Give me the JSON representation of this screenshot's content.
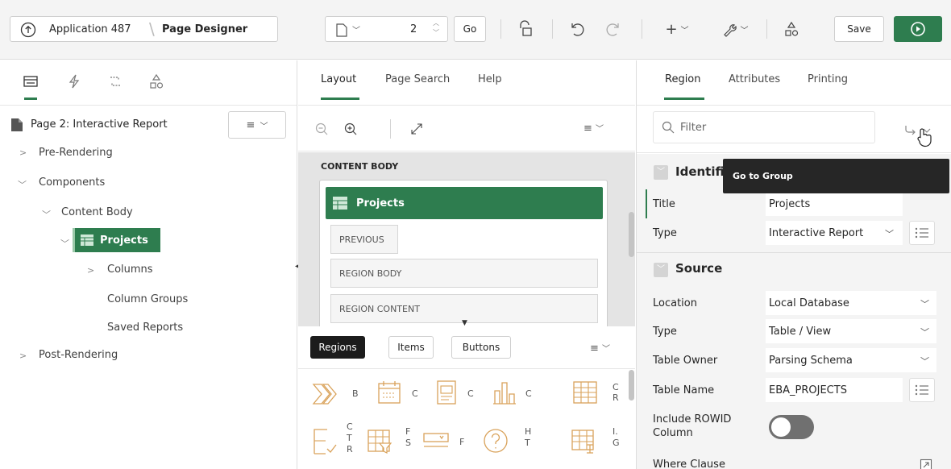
{
  "header": {
    "app_label": "Application 487",
    "page_designer_label": "Page Designer",
    "page_number": "2",
    "go_label": "Go",
    "save_label": "Save"
  },
  "left": {
    "page_title": "Page 2: Interactive Report",
    "tree": {
      "pre_rendering": "Pre-Rendering",
      "components": "Components",
      "content_body": "Content Body",
      "projects": "Projects",
      "columns": "Columns",
      "column_groups": "Column Groups",
      "saved_reports": "Saved Reports",
      "post_rendering": "Post-Rendering"
    }
  },
  "middle": {
    "tabs": [
      "Layout",
      "Page Search",
      "Help"
    ],
    "content_body_label": "CONTENT BODY",
    "region_title": "Projects",
    "slots": [
      "PREVIOUS",
      "REGION BODY",
      "REGION CONTENT"
    ],
    "gallery_tabs": [
      "Regions",
      "Items",
      "Buttons"
    ],
    "gallery_row1_letters": [
      "B",
      "C",
      "C",
      "C",
      "C\nR"
    ],
    "gallery_row2_letters": [
      "C\nT\nR",
      "F\nS",
      "F",
      "H\nT",
      "I.\nG"
    ]
  },
  "right": {
    "tabs": [
      "Region",
      "Attributes",
      "Printing"
    ],
    "filter_placeholder": "Filter",
    "tooltip": "Go to Group",
    "identification_heading": "Identification",
    "source_heading": "Source",
    "props": {
      "title_label": "Title",
      "title_value": "Projects",
      "type_label": "Type",
      "type_value": "Interactive Report",
      "location_label": "Location",
      "location_value": "Local Database",
      "src_type_label": "Type",
      "src_type_value": "Table / View",
      "owner_label": "Table Owner",
      "owner_value": "Parsing Schema",
      "table_label": "Table Name",
      "table_value": "EBA_PROJECTS",
      "rowid_label": "Include ROWID Column",
      "where_label": "Where Clause"
    }
  },
  "colors": {
    "accent": "#2e7d4f",
    "tooltip_bg": "#262626"
  }
}
